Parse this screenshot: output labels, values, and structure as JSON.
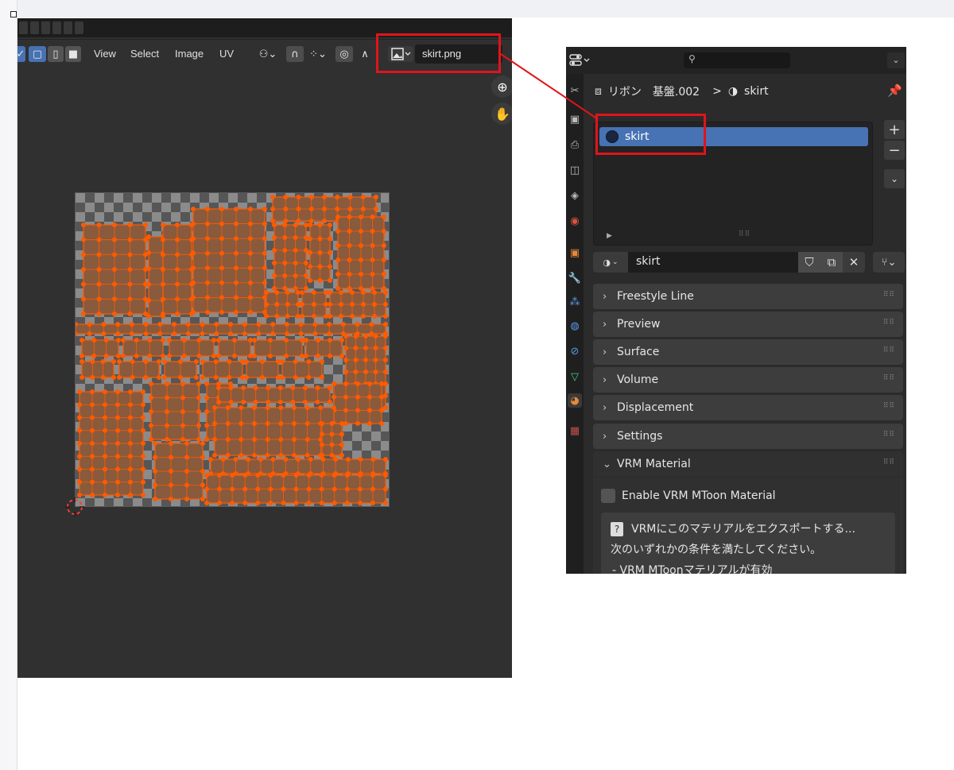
{
  "uv_editor": {
    "menus": [
      "View",
      "Select",
      "Image",
      "UV"
    ],
    "image_name": "skirt.png"
  },
  "properties": {
    "search_placeholder": "",
    "breadcrumb": {
      "object": "リボン",
      "data": "基盤.002",
      "separator": ">",
      "material": "skirt"
    },
    "material_slots": [
      {
        "name": "skirt",
        "selected": true
      }
    ],
    "material_name": "skirt",
    "panels": [
      {
        "label": "Freestyle Line",
        "expanded": false
      },
      {
        "label": "Preview",
        "expanded": false
      },
      {
        "label": "Surface",
        "expanded": false
      },
      {
        "label": "Volume",
        "expanded": false
      },
      {
        "label": "Displacement",
        "expanded": false
      },
      {
        "label": "Settings",
        "expanded": false
      },
      {
        "label": "VRM Material",
        "expanded": true
      }
    ],
    "vrm": {
      "checkbox_label": "Enable VRM MToon Material",
      "checkbox_checked": false,
      "info_line1": "VRMにこのマテリアルをエクスポートする...",
      "info_line2": "次のいずれかの条件を満たしてください。",
      "info_line3": "- VRM MToonマテリアルが有効"
    }
  },
  "colors": {
    "highlight_red": "#e0141b",
    "selection_blue": "#4772b3",
    "uv_orange": "#ff5a00"
  }
}
